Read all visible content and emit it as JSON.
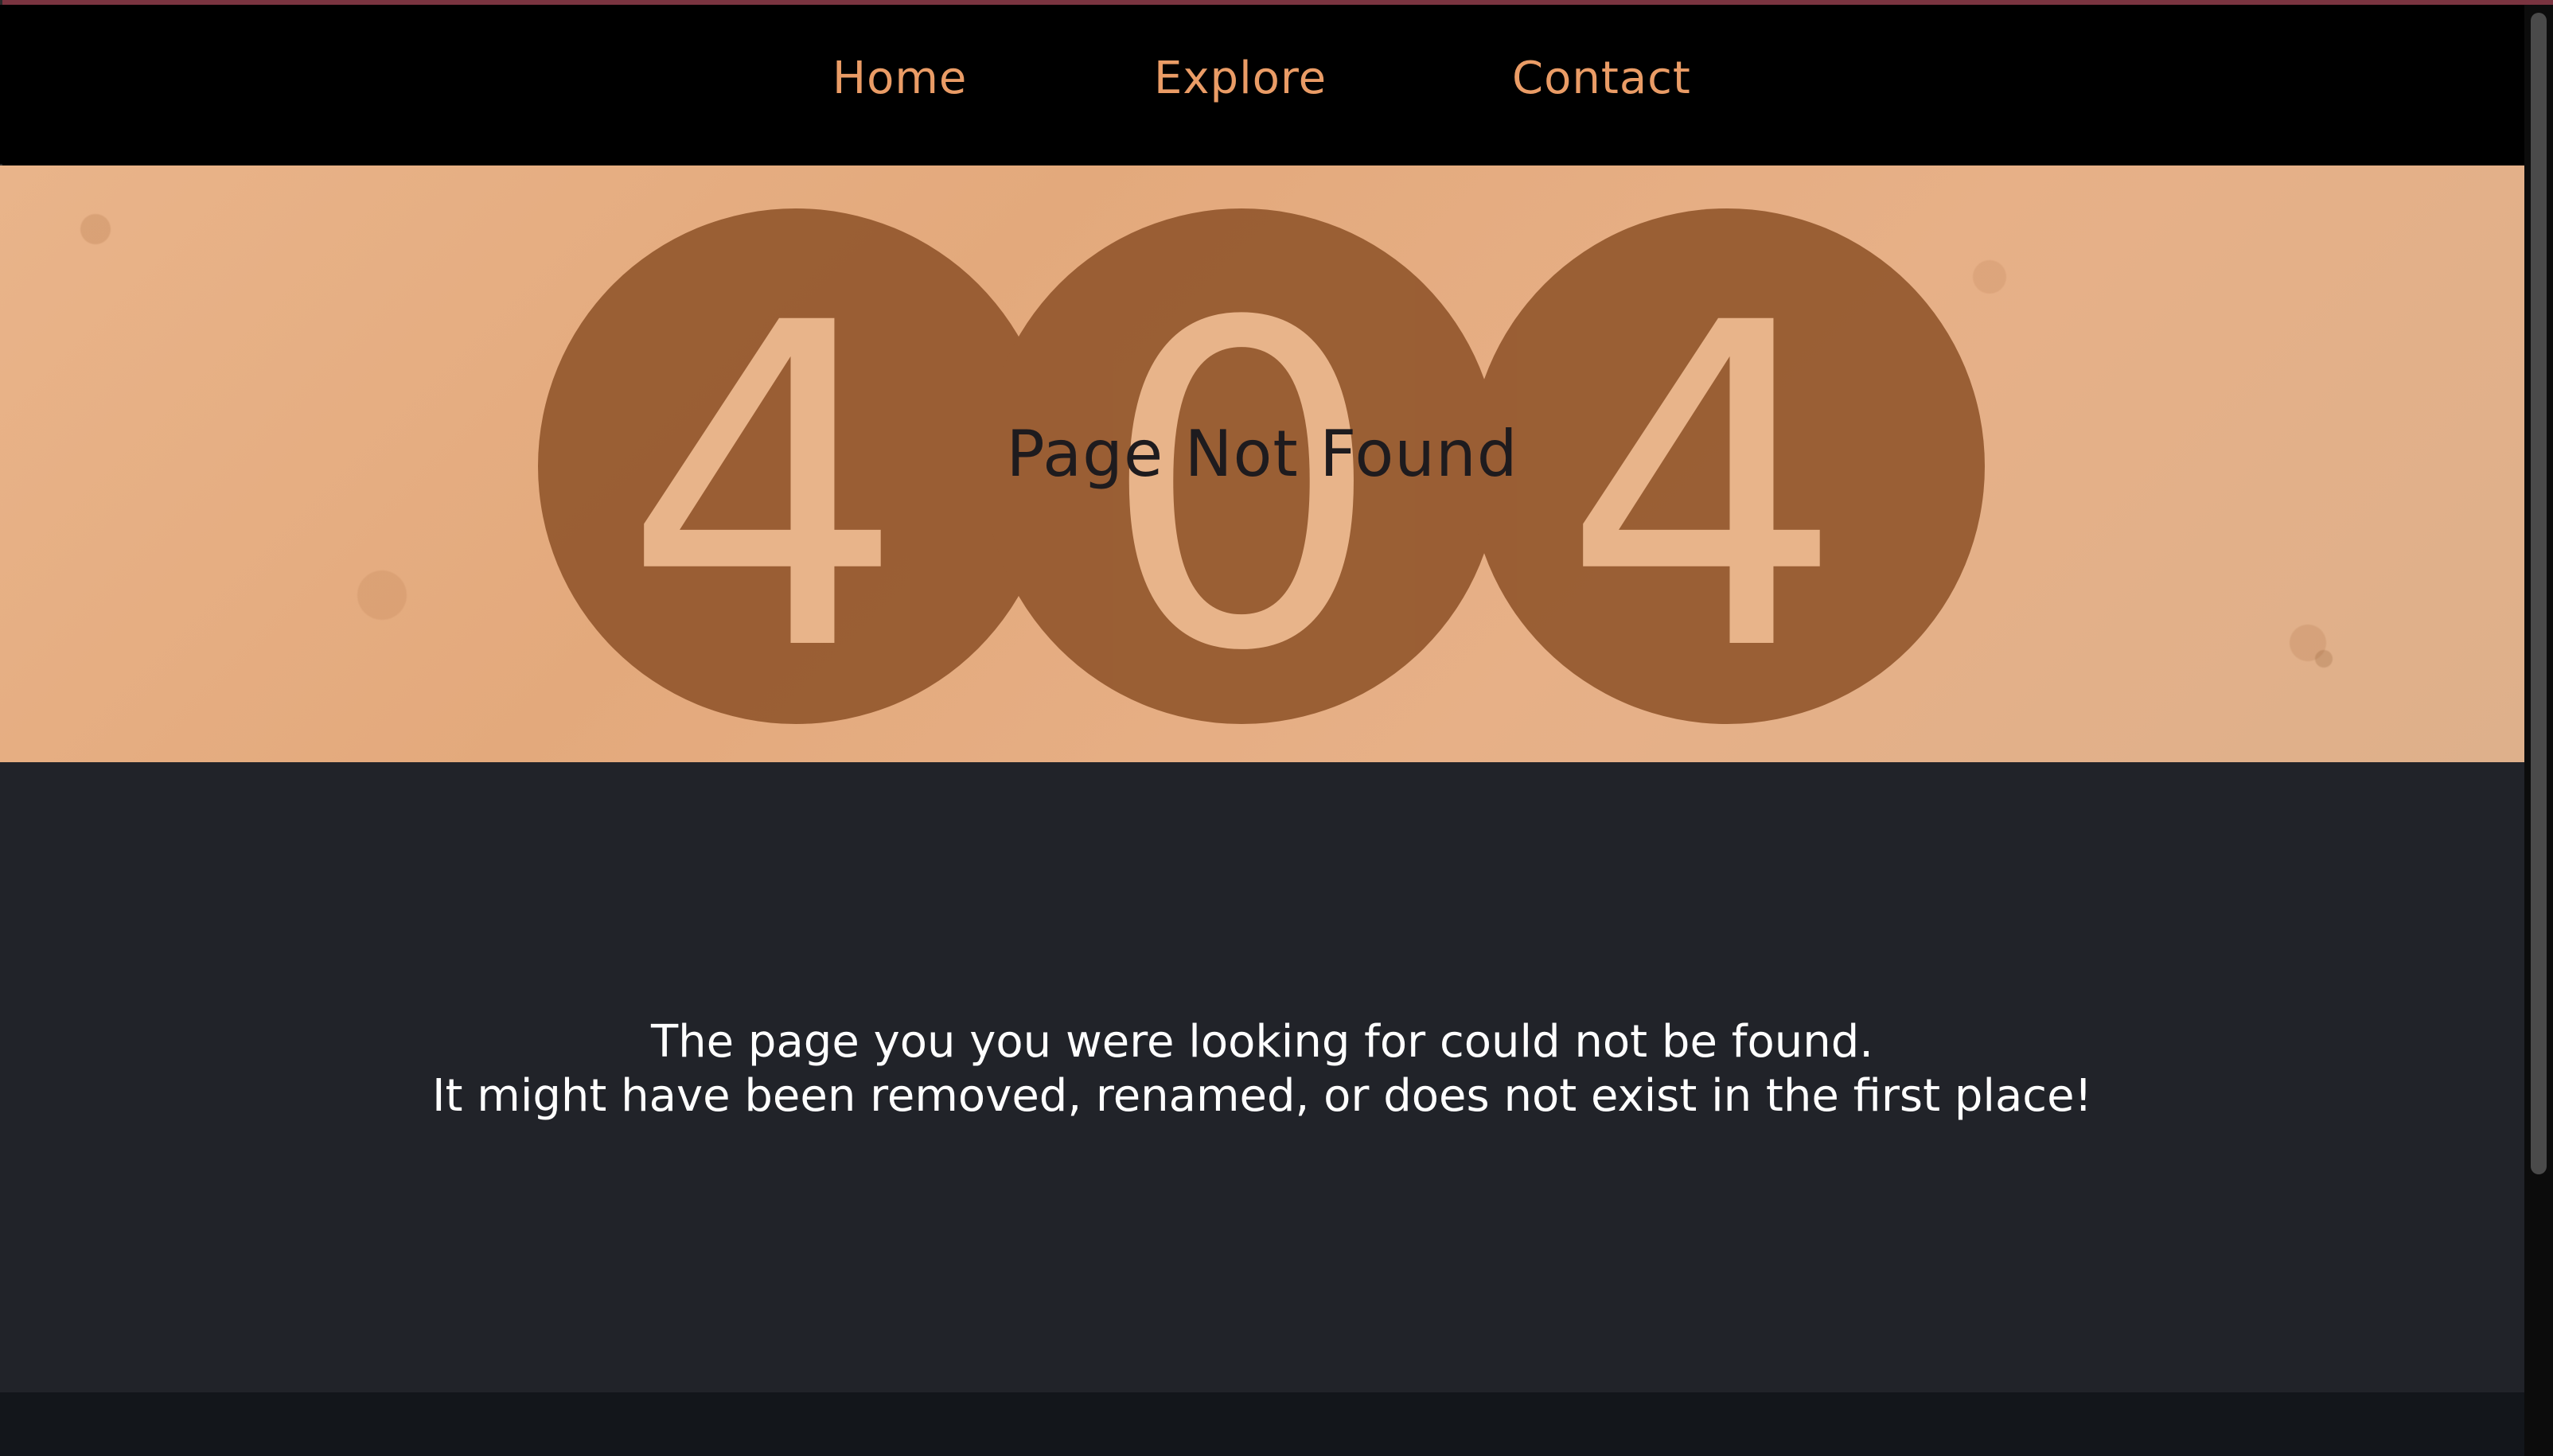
{
  "nav": {
    "items": [
      {
        "label": "Home"
      },
      {
        "label": "Explore"
      },
      {
        "label": "Contact"
      }
    ],
    "link_color": "#ea9c66"
  },
  "hero": {
    "watermark": "404",
    "title": "Page Not Found",
    "background_color": "#e3a97c",
    "circle_color": "#94582e"
  },
  "message": {
    "line1": "The page you you were looking for could not be found.",
    "line2": "It might have been removed, renamed, or does not exist in the first place!"
  },
  "colors": {
    "content_bg": "#212329",
    "footer_bg": "#13161b",
    "nav_bg": "#000000"
  }
}
